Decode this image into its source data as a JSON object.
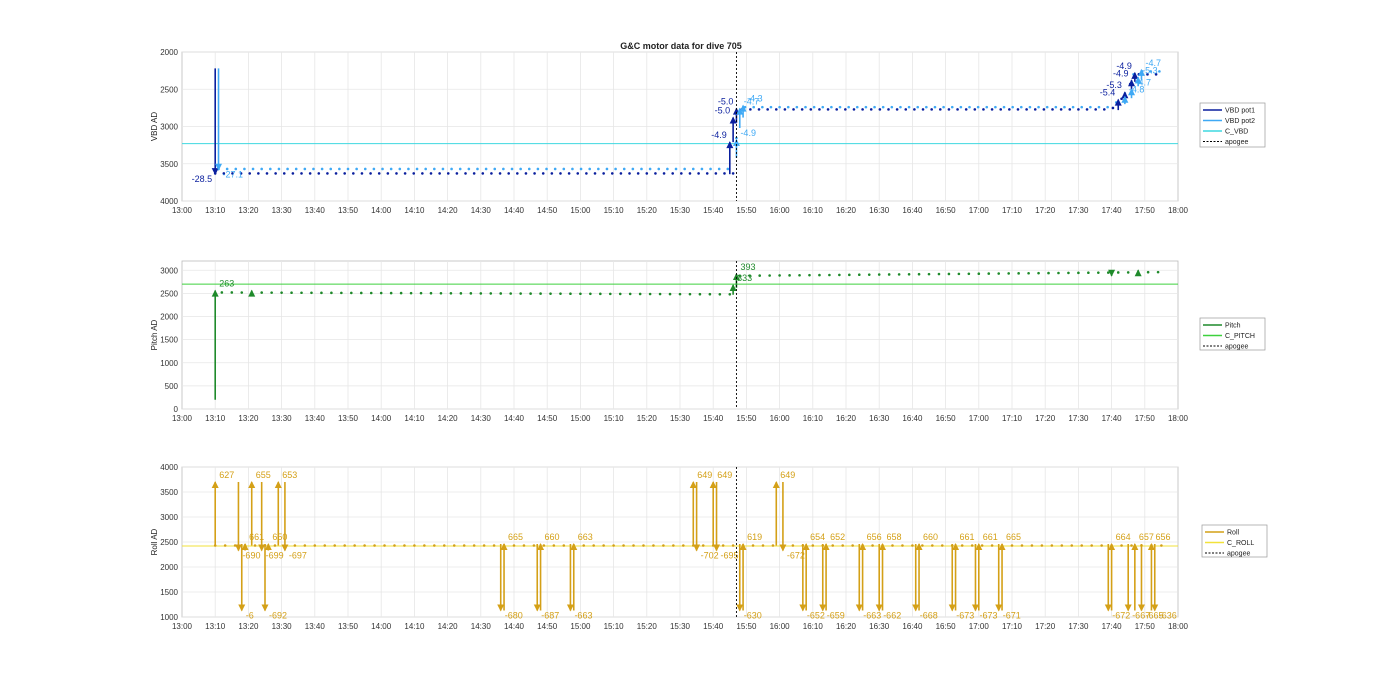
{
  "figure": {
    "title": "G&C motor data for dive 705",
    "time_ticks": [
      "13:00",
      "13:10",
      "13:20",
      "13:30",
      "13:40",
      "13:50",
      "14:00",
      "14:10",
      "14:20",
      "14:30",
      "14:40",
      "14:50",
      "15:00",
      "15:10",
      "15:20",
      "15:30",
      "15:40",
      "15:50",
      "16:00",
      "16:10",
      "16:20",
      "16:30",
      "16:40",
      "16:50",
      "17:00",
      "17:10",
      "17:20",
      "17:30",
      "17:40",
      "17:50",
      "18:00"
    ],
    "colors": {
      "vbd_pot1": "#0a1f9e",
      "vbd_pot2": "#3fa9f5",
      "c_vbd": "#3fd8e0",
      "pitch": "#1f8a2b",
      "c_pitch": "#3dd13d",
      "roll": "#d4a017",
      "c_roll": "#f2e23a",
      "apogee": "#000000",
      "grid": "#e6e6e6"
    }
  },
  "chart_data": [
    {
      "type": "scatter",
      "ylabel": "VBD AD",
      "y_reversed": true,
      "xlim": [
        "13:00",
        "18:00"
      ],
      "ylim": [
        2000,
        4000
      ],
      "y_ticks": [
        2000,
        2500,
        3000,
        3500,
        4000
      ],
      "grid": true,
      "legend_position": "right",
      "legend": [
        "VBD pot1",
        "VBD pot2",
        "C_VBD",
        "apogee"
      ],
      "apogee_time": "15:47",
      "reference_lines": [
        {
          "name": "C_VBD",
          "y": 3230
        }
      ],
      "series": [
        {
          "name": "VBD pot1",
          "marker": "dots",
          "x_start": "13:10",
          "x_end": "17:55",
          "segments": [
            [
              "13:10",
              3630
            ],
            [
              "15:46",
              3630
            ],
            [
              "15:47",
              2770
            ],
            [
              "17:40",
              2770
            ],
            [
              "17:44",
              2580
            ],
            [
              "17:47",
              2300
            ],
            [
              "17:55",
              2300
            ]
          ]
        },
        {
          "name": "VBD pot2",
          "marker": "dots",
          "x_start": "13:11",
          "x_end": "17:56",
          "segments": [
            [
              "13:11",
              3570
            ],
            [
              "15:46",
              3570
            ],
            [
              "15:48",
              2740
            ],
            [
              "17:40",
              2740
            ],
            [
              "17:44",
              2560
            ],
            [
              "17:47",
              2260
            ],
            [
              "17:56",
              2260
            ]
          ]
        }
      ],
      "events": [
        {
          "series": "VBD pot1",
          "t": "13:10",
          "y0": 2220,
          "y1": 3640,
          "dir": "down",
          "label": "-28.5",
          "label_anchor": "end"
        },
        {
          "series": "VBD pot2",
          "t": "13:11",
          "y0": 2220,
          "y1": 3580,
          "dir": "down",
          "label": "-27.1",
          "label_anchor": "start"
        },
        {
          "series": "VBD pot1",
          "t": "15:45",
          "y0": 3640,
          "y1": 3210,
          "dir": "up",
          "label": "-4.9",
          "label_anchor": "end"
        },
        {
          "series": "VBD pot1",
          "t": "15:46",
          "y0": 3210,
          "y1": 2880,
          "dir": "up",
          "label": "-5.0",
          "label_anchor": "end"
        },
        {
          "series": "VBD pot1",
          "t": "15:47",
          "y0": 2950,
          "y1": 2760,
          "dir": "up",
          "label": "-5.0",
          "label_anchor": "end"
        },
        {
          "series": "VBD pot2",
          "t": "15:47",
          "y0": 3420,
          "y1": 3180,
          "dir": "up",
          "label": "-4.9",
          "label_anchor": "start"
        },
        {
          "series": "VBD pot2",
          "t": "15:48",
          "y0": 3020,
          "y1": 2760,
          "dir": "up",
          "label": "-4.7",
          "label_anchor": "start"
        },
        {
          "series": "VBD pot2",
          "t": "15:49",
          "y0": 2880,
          "y1": 2720,
          "dir": "up",
          "label": "-4.3",
          "label_anchor": "start"
        },
        {
          "series": "VBD pot1",
          "t": "17:42",
          "y0": 2780,
          "y1": 2640,
          "dir": "up",
          "label": "-5.4",
          "label_anchor": "end"
        },
        {
          "series": "VBD pot1",
          "t": "17:44",
          "y0": 2680,
          "y1": 2540,
          "dir": "up",
          "label": "-5.3",
          "label_anchor": "end"
        },
        {
          "series": "VBD pot1",
          "t": "17:46",
          "y0": 2500,
          "y1": 2380,
          "dir": "up",
          "label": "-4.9",
          "label_anchor": "end"
        },
        {
          "series": "VBD pot1",
          "t": "17:47",
          "y0": 2400,
          "y1": 2280,
          "dir": "up",
          "label": "-4.9",
          "label_anchor": "end"
        },
        {
          "series": "VBD pot2",
          "t": "17:44",
          "y0": 2700,
          "y1": 2600,
          "dir": "up",
          "label": "-4.8",
          "label_anchor": "start"
        },
        {
          "series": "VBD pot2",
          "t": "17:46",
          "y0": 2620,
          "y1": 2500,
          "dir": "up",
          "label": "-4.7",
          "label_anchor": "start"
        },
        {
          "series": "VBD pot2",
          "t": "17:48",
          "y0": 2460,
          "y1": 2340,
          "dir": "up",
          "label": "-5.3",
          "label_anchor": "start"
        },
        {
          "series": "VBD pot2",
          "t": "17:49",
          "y0": 2370,
          "y1": 2240,
          "dir": "up",
          "label": "-4.7",
          "label_anchor": "start"
        }
      ]
    },
    {
      "type": "scatter",
      "ylabel": "Pitch AD",
      "xlim": [
        "13:00",
        "18:00"
      ],
      "ylim": [
        0,
        3200
      ],
      "y_ticks": [
        0,
        500,
        1000,
        1500,
        2000,
        2500,
        3000
      ],
      "grid": true,
      "legend_position": "right",
      "legend": [
        "Pitch",
        "C_PITCH",
        "apogee"
      ],
      "apogee_time": "15:47",
      "reference_lines": [
        {
          "name": "C_PITCH",
          "y": 2700
        }
      ],
      "series": [
        {
          "name": "Pitch",
          "marker": "dots",
          "x_start": "13:12",
          "x_end": "17:55",
          "segments": [
            [
              "13:12",
              2520
            ],
            [
              "15:45",
              2480
            ],
            [
              "15:47",
              2880
            ],
            [
              "17:55",
              2960
            ]
          ]
        }
      ],
      "events": [
        {
          "series": "Pitch",
          "t": "13:10",
          "y0": 200,
          "y1": 2560,
          "dir": "up",
          "label": "263",
          "label_anchor": "start"
        },
        {
          "series": "Pitch",
          "t": "13:21",
          "y0": 2480,
          "y1": 2560,
          "dir": "up",
          "label": "",
          "label_anchor": "start"
        },
        {
          "series": "Pitch",
          "t": "15:46",
          "y0": 2470,
          "y1": 2680,
          "dir": "up",
          "label": "333",
          "label_anchor": "start"
        },
        {
          "series": "Pitch",
          "t": "15:47",
          "y0": 2620,
          "y1": 2920,
          "dir": "up",
          "label": "393",
          "label_anchor": "start"
        },
        {
          "series": "Pitch",
          "t": "17:40",
          "y0": 2960,
          "y1": 2880,
          "dir": "down",
          "label": "",
          "label_anchor": "start"
        },
        {
          "series": "Pitch",
          "t": "17:48",
          "y0": 2940,
          "y1": 3000,
          "dir": "up",
          "label": "",
          "label_anchor": "start"
        }
      ]
    },
    {
      "type": "scatter",
      "ylabel": "Roll AD",
      "xlim": [
        "13:00",
        "18:00"
      ],
      "ylim": [
        1000,
        4000
      ],
      "y_ticks": [
        1000,
        1500,
        2000,
        2500,
        3000,
        3500,
        4000
      ],
      "grid": true,
      "legend_position": "right",
      "legend": [
        "Roll",
        "C_ROLL",
        "apogee"
      ],
      "apogee_time": "15:47",
      "reference_lines": [
        {
          "name": "C_ROLL",
          "y": 2420
        }
      ],
      "series": [
        {
          "name": "Roll",
          "marker": "dots",
          "x_start": "13:10",
          "x_end": "17:56",
          "segments": [
            [
              "13:10",
              2430
            ],
            [
              "17:56",
              2430
            ]
          ]
        }
      ],
      "events": [
        {
          "series": "Roll",
          "t": "13:10",
          "y0": 2430,
          "y1": 3700,
          "dir": "up",
          "label": "627",
          "label_anchor": "start"
        },
        {
          "series": "Roll",
          "t": "13:21",
          "y0": 2430,
          "y1": 3700,
          "dir": "up",
          "label": "655",
          "label_anchor": "start"
        },
        {
          "series": "Roll",
          "t": "13:29",
          "y0": 2430,
          "y1": 3700,
          "dir": "up",
          "label": "653",
          "label_anchor": "start"
        },
        {
          "series": "Roll",
          "t": "13:17",
          "y0": 3700,
          "y1": 2330,
          "dir": "down",
          "label": "-690",
          "label_anchor": "start"
        },
        {
          "series": "Roll",
          "t": "13:24",
          "y0": 3700,
          "y1": 2330,
          "dir": "down",
          "label": "-699",
          "label_anchor": "start"
        },
        {
          "series": "Roll",
          "t": "13:31",
          "y0": 3700,
          "y1": 2330,
          "dir": "down",
          "label": "-697",
          "label_anchor": "start"
        },
        {
          "series": "Roll",
          "t": "13:19",
          "y0": 2330,
          "y1": 2460,
          "dir": "up",
          "label": "661",
          "label_anchor": "start"
        },
        {
          "series": "Roll",
          "t": "13:26",
          "y0": 2330,
          "y1": 2460,
          "dir": "up",
          "label": "650",
          "label_anchor": "start"
        },
        {
          "series": "Roll",
          "t": "13:18",
          "y0": 2460,
          "y1": 1130,
          "dir": "down",
          "label": "-6",
          "label_anchor": "start"
        },
        {
          "series": "Roll",
          "t": "13:25",
          "y0": 2460,
          "y1": 1130,
          "dir": "down",
          "label": "-692",
          "label_anchor": "start"
        },
        {
          "series": "Roll",
          "t": "14:36",
          "y0": 2460,
          "y1": 1130,
          "dir": "down",
          "label": "-680",
          "label_anchor": "start"
        },
        {
          "series": "Roll",
          "t": "14:37",
          "y0": 1130,
          "y1": 2460,
          "dir": "up",
          "label": "665",
          "label_anchor": "start"
        },
        {
          "series": "Roll",
          "t": "14:47",
          "y0": 2460,
          "y1": 1130,
          "dir": "down",
          "label": "-687",
          "label_anchor": "start"
        },
        {
          "series": "Roll",
          "t": "14:48",
          "y0": 1130,
          "y1": 2460,
          "dir": "up",
          "label": "660",
          "label_anchor": "start"
        },
        {
          "series": "Roll",
          "t": "14:57",
          "y0": 2460,
          "y1": 1130,
          "dir": "down",
          "label": "-663",
          "label_anchor": "start"
        },
        {
          "series": "Roll",
          "t": "14:58",
          "y0": 1130,
          "y1": 2460,
          "dir": "up",
          "label": "663",
          "label_anchor": "start"
        },
        {
          "series": "Roll",
          "t": "15:34",
          "y0": 2430,
          "y1": 3700,
          "dir": "up",
          "label": "649",
          "label_anchor": "start"
        },
        {
          "series": "Roll",
          "t": "15:35",
          "y0": 3700,
          "y1": 2330,
          "dir": "down",
          "label": "-702",
          "label_anchor": "start"
        },
        {
          "series": "Roll",
          "t": "15:40",
          "y0": 2430,
          "y1": 3700,
          "dir": "up",
          "label": "649",
          "label_anchor": "start"
        },
        {
          "series": "Roll",
          "t": "15:41",
          "y0": 3700,
          "y1": 2330,
          "dir": "down",
          "label": "-695",
          "label_anchor": "start"
        },
        {
          "series": "Roll",
          "t": "15:48",
          "y0": 2460,
          "y1": 1130,
          "dir": "down",
          "label": "-630",
          "label_anchor": "start"
        },
        {
          "series": "Roll",
          "t": "15:49",
          "y0": 1130,
          "y1": 2460,
          "dir": "up",
          "label": "619",
          "label_anchor": "start"
        },
        {
          "series": "Roll",
          "t": "15:59",
          "y0": 2430,
          "y1": 3700,
          "dir": "up",
          "label": "649",
          "label_anchor": "start"
        },
        {
          "series": "Roll",
          "t": "16:01",
          "y0": 3700,
          "y1": 2330,
          "dir": "down",
          "label": "-672",
          "label_anchor": "start"
        },
        {
          "series": "Roll",
          "t": "16:07",
          "y0": 2460,
          "y1": 1130,
          "dir": "down",
          "label": "-652",
          "label_anchor": "start"
        },
        {
          "series": "Roll",
          "t": "16:08",
          "y0": 1130,
          "y1": 2460,
          "dir": "up",
          "label": "654",
          "label_anchor": "start"
        },
        {
          "series": "Roll",
          "t": "16:13",
          "y0": 2460,
          "y1": 1130,
          "dir": "down",
          "label": "-659",
          "label_anchor": "start"
        },
        {
          "series": "Roll",
          "t": "16:14",
          "y0": 1130,
          "y1": 2460,
          "dir": "up",
          "label": "652",
          "label_anchor": "start"
        },
        {
          "series": "Roll",
          "t": "16:24",
          "y0": 2460,
          "y1": 1130,
          "dir": "down",
          "label": "-663",
          "label_anchor": "start"
        },
        {
          "series": "Roll",
          "t": "16:25",
          "y0": 1130,
          "y1": 2460,
          "dir": "up",
          "label": "656",
          "label_anchor": "start"
        },
        {
          "series": "Roll",
          "t": "16:30",
          "y0": 2460,
          "y1": 1130,
          "dir": "down",
          "label": "-662",
          "label_anchor": "start"
        },
        {
          "series": "Roll",
          "t": "16:31",
          "y0": 1130,
          "y1": 2460,
          "dir": "up",
          "label": "658",
          "label_anchor": "start"
        },
        {
          "series": "Roll",
          "t": "16:41",
          "y0": 2460,
          "y1": 1130,
          "dir": "down",
          "label": "-668",
          "label_anchor": "start"
        },
        {
          "series": "Roll",
          "t": "16:42",
          "y0": 1130,
          "y1": 2460,
          "dir": "up",
          "label": "660",
          "label_anchor": "start"
        },
        {
          "series": "Roll",
          "t": "16:52",
          "y0": 2460,
          "y1": 1130,
          "dir": "down",
          "label": "-673",
          "label_anchor": "start"
        },
        {
          "series": "Roll",
          "t": "16:53",
          "y0": 1130,
          "y1": 2460,
          "dir": "up",
          "label": "661",
          "label_anchor": "start"
        },
        {
          "series": "Roll",
          "t": "16:59",
          "y0": 2460,
          "y1": 1130,
          "dir": "down",
          "label": "-673",
          "label_anchor": "start"
        },
        {
          "series": "Roll",
          "t": "17:00",
          "y0": 1130,
          "y1": 2460,
          "dir": "up",
          "label": "661",
          "label_anchor": "start"
        },
        {
          "series": "Roll",
          "t": "17:06",
          "y0": 2460,
          "y1": 1130,
          "dir": "down",
          "label": "-671",
          "label_anchor": "start"
        },
        {
          "series": "Roll",
          "t": "17:07",
          "y0": 1130,
          "y1": 2460,
          "dir": "up",
          "label": "665",
          "label_anchor": "start"
        },
        {
          "series": "Roll",
          "t": "17:39",
          "y0": 2460,
          "y1": 1130,
          "dir": "down",
          "label": "-672",
          "label_anchor": "start"
        },
        {
          "series": "Roll",
          "t": "17:40",
          "y0": 1130,
          "y1": 2460,
          "dir": "up",
          "label": "664",
          "label_anchor": "start"
        },
        {
          "series": "Roll",
          "t": "17:45",
          "y0": 2460,
          "y1": 1130,
          "dir": "down",
          "label": "-667",
          "label_anchor": "start"
        },
        {
          "series": "Roll",
          "t": "17:47",
          "y0": 1130,
          "y1": 2460,
          "dir": "up",
          "label": "657",
          "label_anchor": "start"
        },
        {
          "series": "Roll",
          "t": "17:49",
          "y0": 2460,
          "y1": 1130,
          "dir": "down",
          "label": "-665",
          "label_anchor": "start"
        },
        {
          "series": "Roll",
          "t": "17:52",
          "y0": 1130,
          "y1": 2460,
          "dir": "up",
          "label": "656",
          "label_anchor": "start"
        },
        {
          "series": "Roll",
          "t": "17:53",
          "y0": 2460,
          "y1": 1130,
          "dir": "down",
          "label": "-636",
          "label_anchor": "start"
        }
      ]
    }
  ]
}
